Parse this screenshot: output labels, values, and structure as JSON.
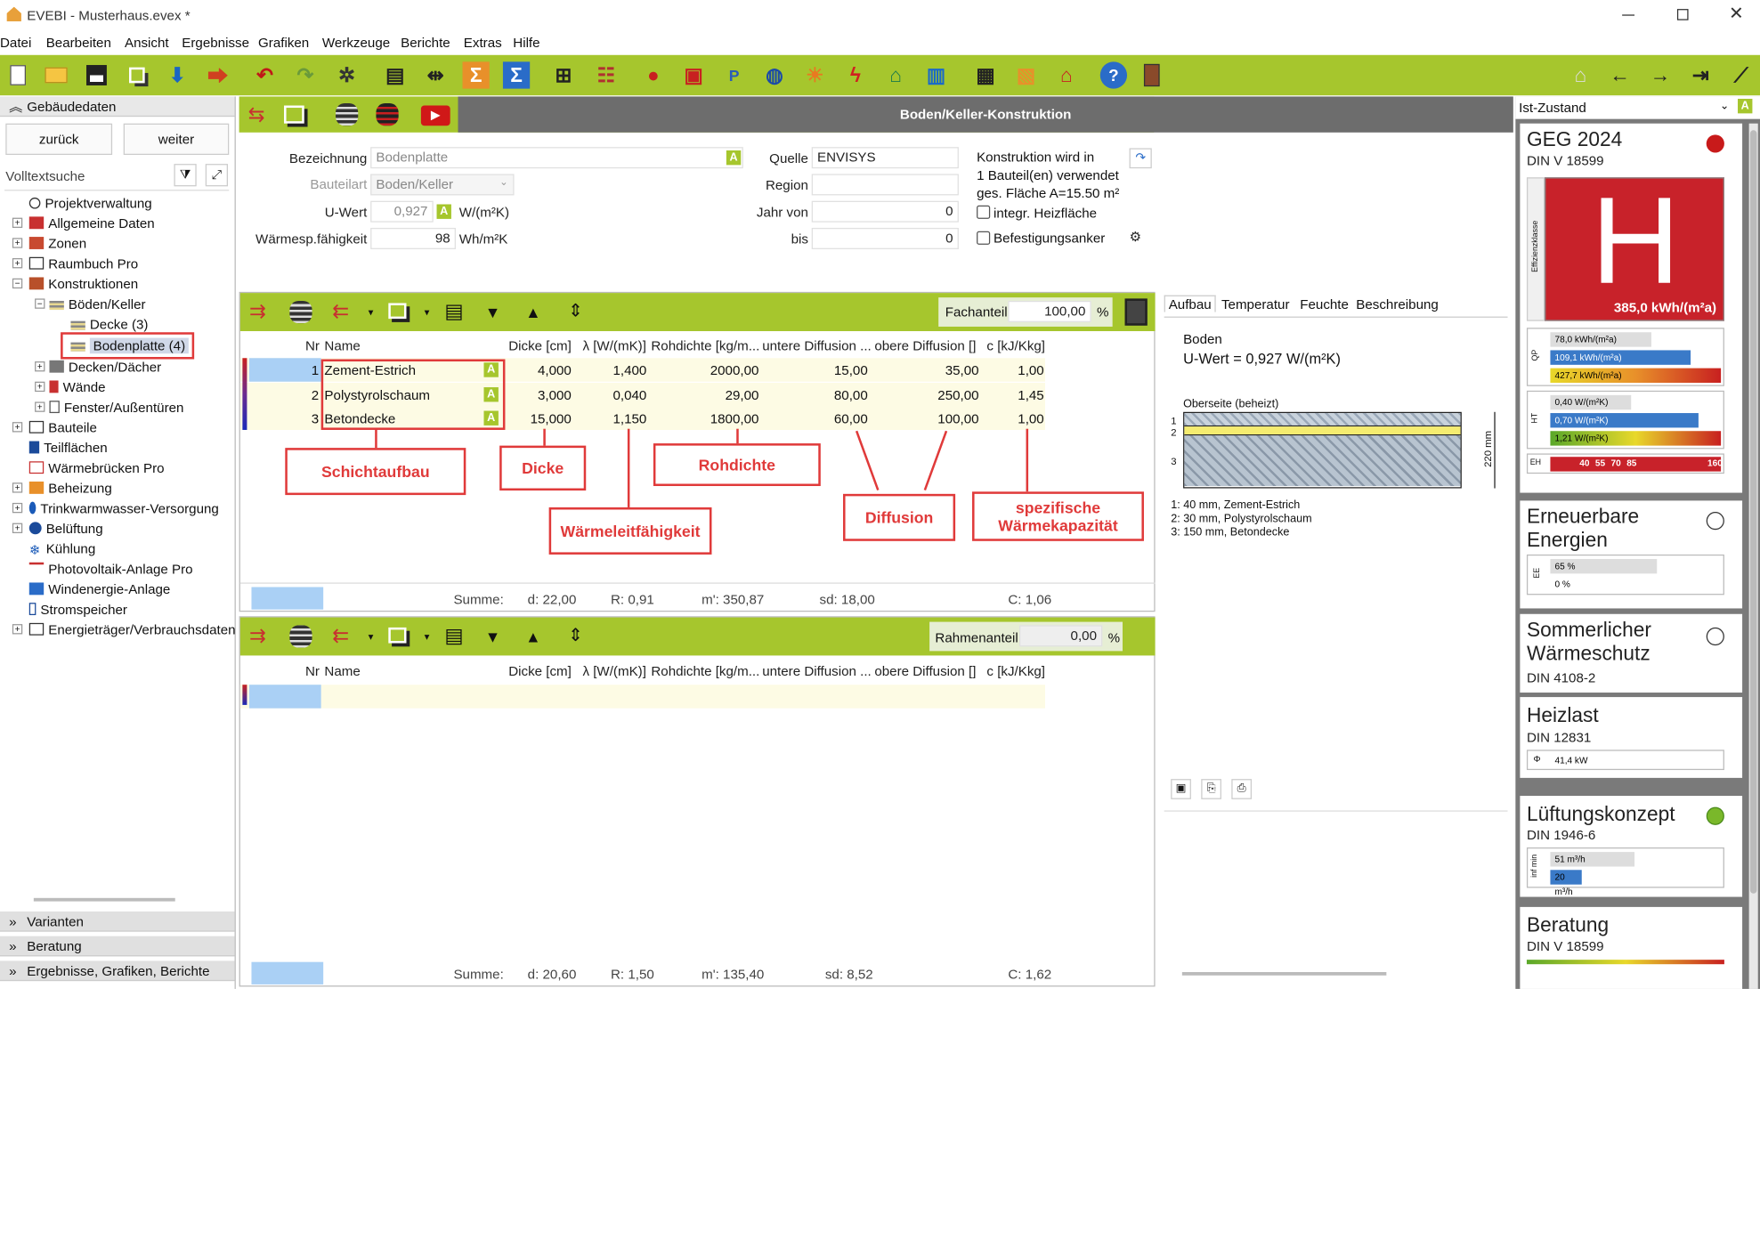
{
  "window": {
    "title": "EVEBI - Musterhaus.evex *"
  },
  "menu": [
    "Datei",
    "Bearbeiten",
    "Ansicht",
    "Ergebnisse",
    "Grafiken",
    "Werkzeuge",
    "Berichte",
    "Extras",
    "Hilfe"
  ],
  "sidebar": {
    "section_title": "Gebäudedaten",
    "back_label": "zurück",
    "next_label": "weiter",
    "search_label": "Volltextsuche",
    "tree": [
      "Projektverwaltung",
      "Allgemeine Daten",
      "Zonen",
      "Raumbuch Pro",
      "Konstruktionen",
      "Böden/Keller",
      "Decke (3)",
      "Bodenplatte (4)",
      "Decken/Dächer",
      "Wände",
      "Fenster/Außentüren",
      "Bauteile",
      "Teilflächen",
      "Wärmebrücken Pro",
      "Beheizung",
      "Trinkwarmwasser-Versorgung",
      "Belüftung",
      "Kühlung",
      "Photovoltaik-Anlage Pro",
      "Windenergie-Anlage",
      "Stromspeicher",
      "Energieträger/Verbrauchsdaten"
    ],
    "bottom_sections": [
      "Varianten",
      "Beratung",
      "Ergebnisse, Grafiken, Berichte"
    ]
  },
  "panel": {
    "title": "Boden/Keller-Konstruktion",
    "bezeichnung_label": "Bezeichnung",
    "bezeichnung_value": "Bodenplatte",
    "bauteilart_label": "Bauteilart",
    "bauteilart_value": "Boden/Keller",
    "uwert_label": "U-Wert",
    "uwert_value": "0,927",
    "uwert_unit": "W/(m²K)",
    "waerme_label": "Wärmesp.fähigkeit",
    "waerme_value": "98",
    "waerme_unit": "Wh/m²K",
    "quelle_label": "Quelle",
    "quelle_value": "ENVISYS",
    "region_label": "Region",
    "region_value": "",
    "jahrvon_label": "Jahr von",
    "jahrvon_value": "0",
    "bis_label": "bis",
    "bis_value": "0",
    "konstr_text1": "Konstruktion wird in",
    "konstr_text2": "1 Bauteil(en) verwendet",
    "konstr_text3": "ges. Fläche A=15.50 m²",
    "integr_label": "integr. Heizfläche",
    "anker_label": "Befestigungsanker"
  },
  "table1": {
    "fachanteil_label": "Fachanteil",
    "fachanteil_value": "100,00",
    "percent": "%",
    "headers": [
      "Nr",
      "Name",
      "Dicke [cm]",
      "λ [W/(mK)]",
      "Rohdichte [kg/m...",
      "untere Diffusion ...",
      "obere Diffusion []",
      "c [kJ/Kkg]"
    ],
    "rows": [
      {
        "nr": "1",
        "name": "Zement-Estrich",
        "dicke": "4,000",
        "lambda": "1,400",
        "rho": "2000,00",
        "ud": "15,00",
        "od": "35,00",
        "c": "1,00"
      },
      {
        "nr": "2",
        "name": "Polystyrolschaum",
        "dicke": "3,000",
        "lambda": "0,040",
        "rho": "29,00",
        "ud": "80,00",
        "od": "250,00",
        "c": "1,45"
      },
      {
        "nr": "3",
        "name": "Betondecke",
        "dicke": "15,000",
        "lambda": "1,150",
        "rho": "1800,00",
        "ud": "60,00",
        "od": "100,00",
        "c": "1,00"
      }
    ],
    "sum": {
      "label": "Summe:",
      "d": "d: 22,00",
      "r": "R: 0,91",
      "m": "m': 350,87",
      "sd": "sd: 18,00",
      "c": "C: 1,06"
    }
  },
  "annotations": {
    "schicht": "Schichtaufbau",
    "dicke": "Dicke",
    "rohdichte": "Rohdichte",
    "waerme": "Wärmeleitfähigkeit",
    "diffusion": "Diffusion",
    "spez1": "spezifische",
    "spez2": "Wärmekapazität"
  },
  "table2": {
    "rahmen_label": "Rahmenanteil",
    "rahmen_value": "0,00",
    "percent": "%",
    "headers": [
      "Nr",
      "Name",
      "Dicke [cm]",
      "λ [W/(mK)]",
      "Rohdichte [kg/m...",
      "untere Diffusion ...",
      "obere Diffusion []",
      "c [kJ/Kkg]"
    ],
    "sum": {
      "label": "Summe:",
      "d": "d: 20,60",
      "r": "R: 1,50",
      "m": "m': 135,40",
      "sd": "sd: 8,52",
      "c": "C: 1,62"
    }
  },
  "preview": {
    "tabs": [
      "Aufbau",
      "Temperatur",
      "Feuchte",
      "Beschreibung"
    ],
    "title": "Boden",
    "uwert": "U-Wert = 0,927 W/(m²K)",
    "oberseite": "Oberseite (beheizt)",
    "dim": "220 mm",
    "layers": [
      "1:  40 mm, Zement-Estrich",
      "2:  30 mm, Polystyrolschaum",
      "3:  150 mm, Betondecke"
    ],
    "labels": [
      "1",
      "2",
      "3"
    ]
  },
  "right": {
    "state": "Ist-Zustand",
    "geg": {
      "title": "GEG 2024",
      "sub": "DIN V 18599",
      "class": "H",
      "value": "385,0 kWh/(m²a)",
      "side": "Effizienzklasse",
      "qp": [
        "78,0 kWh/(m²a)",
        "109,1 kWh/(m²a)",
        "427,7 kWh/(m²a)"
      ],
      "qp_label": "QP",
      "ht": [
        "0,40 W/(m²K)",
        "0,70 W/(m²K)",
        "1,21 W/(m²K)"
      ],
      "ht_label": "HT",
      "eh_label": "EH",
      "eh": [
        "40",
        "55",
        "70",
        "85",
        "160"
      ]
    },
    "ee": {
      "title1": "Erneuerbare",
      "title2": "Energien",
      "bars": [
        "65 %",
        "0 %"
      ],
      "label": "EE"
    },
    "sw": {
      "title1": "Sommerlicher",
      "title2": "Wärmeschutz",
      "sub": "DIN 4108-2"
    },
    "hl": {
      "title": "Heizlast",
      "sub": "DIN 12831",
      "value": "41,4 kW"
    },
    "lk": {
      "title": "Lüftungskonzept",
      "sub": "DIN 1946-6",
      "bars": [
        "51 m³/h",
        "20 m³/h"
      ],
      "label": "inf min"
    },
    "ber": {
      "title": "Beratung",
      "sub": "DIN V 18599"
    }
  },
  "colors": {
    "green": "#a6c62d",
    "header_gray": "#6d6d6d",
    "selection": "#aad0f5",
    "red": "#e03a3a",
    "row_bg": "#fdfbe4"
  }
}
